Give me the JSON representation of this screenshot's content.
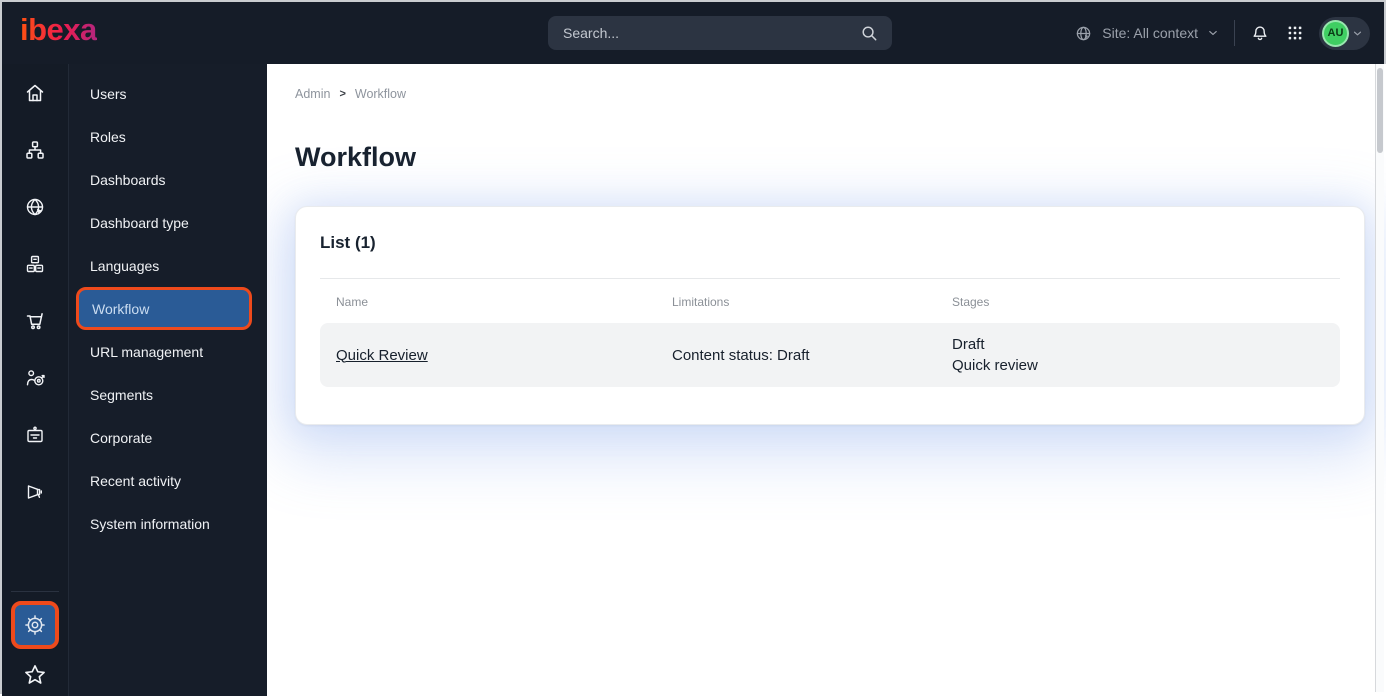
{
  "topbar": {
    "logo_text": "ibexa",
    "search": {
      "placeholder": "Search..."
    },
    "site_context": {
      "label": "Site: All context"
    },
    "avatar": {
      "initials": "AU"
    }
  },
  "icon_rail": {
    "items": [
      {
        "icon": "home-icon"
      },
      {
        "icon": "content-tree-icon"
      },
      {
        "icon": "site-globe-icon"
      },
      {
        "icon": "products-boxes-icon"
      },
      {
        "icon": "commerce-cart-icon"
      },
      {
        "icon": "customers-target-icon"
      },
      {
        "icon": "corporate-badge-icon"
      },
      {
        "icon": "marketing-megaphone-icon"
      }
    ],
    "bottom": [
      {
        "icon": "settings-gear-icon",
        "active": true,
        "highlighted": true
      },
      {
        "icon": "bookmarks-star-icon",
        "active": false,
        "highlighted": false
      }
    ]
  },
  "sidebar": {
    "items": [
      {
        "label": "Users",
        "active": false
      },
      {
        "label": "Roles",
        "active": false
      },
      {
        "label": "Dashboards",
        "active": false
      },
      {
        "label": "Dashboard type",
        "active": false
      },
      {
        "label": "Languages",
        "active": false
      },
      {
        "label": "Workflow",
        "active": true,
        "highlighted": true
      },
      {
        "label": "URL management",
        "active": false
      },
      {
        "label": "Segments",
        "active": false
      },
      {
        "label": "Corporate",
        "active": false
      },
      {
        "label": "Recent activity",
        "active": false
      },
      {
        "label": "System information",
        "active": false
      }
    ]
  },
  "main": {
    "breadcrumb": {
      "items": [
        "Admin",
        "Workflow"
      ],
      "separator": ">"
    },
    "title": "Workflow",
    "card": {
      "heading": "List (1)",
      "table": {
        "columns": [
          "Name",
          "Limitations",
          "Stages"
        ],
        "rows": [
          {
            "name": "Quick Review",
            "limitations": "Content status: Draft",
            "stages": [
              "Draft",
              "Quick review"
            ]
          }
        ]
      }
    }
  },
  "colors": {
    "topbar_bg": "#151C28",
    "highlight_border_orange": "#EE4A1C",
    "active_blue": "#2A5B96",
    "avatar_green": "#3FCE62",
    "logo_gradient_start": "#FF5112",
    "logo_gradient_end": "#B3267E",
    "row_bg": "#F2F3F4"
  }
}
